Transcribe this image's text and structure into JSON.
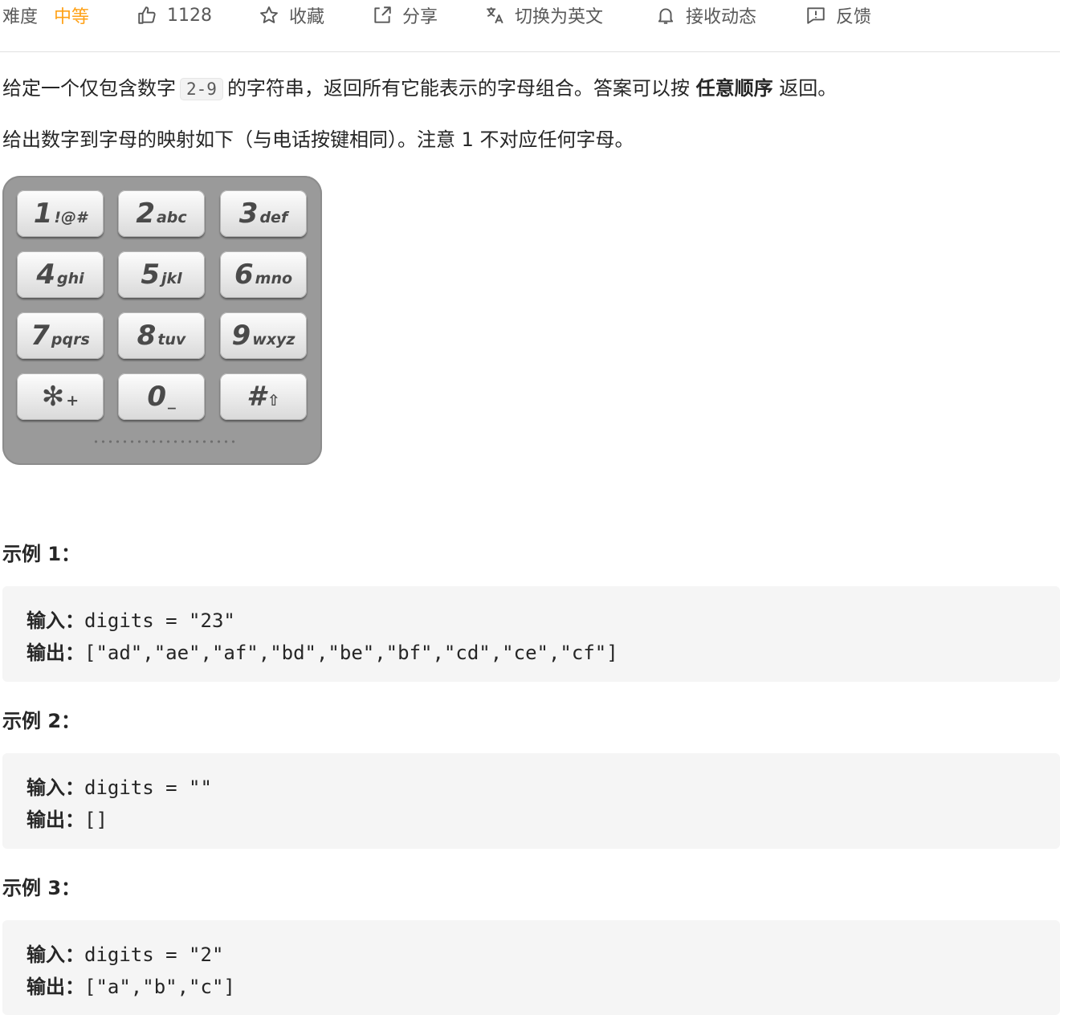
{
  "toolbar": {
    "difficulty_label": "难度",
    "difficulty_value": "中等",
    "difficulty_color": "#ffa116",
    "likes": "1128",
    "favorite": "收藏",
    "share": "分享",
    "translate": "切换为英文",
    "subscribe": "接收动态",
    "feedback": "反馈",
    "icons": [
      "thumbs-up-icon",
      "star-icon",
      "share-icon",
      "translate-icon",
      "bell-icon",
      "feedback-icon"
    ]
  },
  "description": {
    "p1_before": "给定一个仅包含数字",
    "p1_code": "2-9",
    "p1_middle": "的字符串，返回所有它能表示的字母组合。答案可以按",
    "p1_bold": "任意顺序",
    "p1_after": "返回。",
    "p2": "给出数字到字母的映射如下（与电话按键相同）。注意 1 不对应任何字母。"
  },
  "keypad": {
    "keys": [
      {
        "num": "1",
        "letters": "!@#"
      },
      {
        "num": "2",
        "letters": "abc"
      },
      {
        "num": "3",
        "letters": "def"
      },
      {
        "num": "4",
        "letters": "ghi"
      },
      {
        "num": "5",
        "letters": "jkl"
      },
      {
        "num": "6",
        "letters": "mno"
      },
      {
        "num": "7",
        "letters": "pqrs"
      },
      {
        "num": "8",
        "letters": "tuv"
      },
      {
        "num": "9",
        "letters": "wxyz"
      },
      {
        "num": "✻",
        "letters": "+"
      },
      {
        "num": "0",
        "letters": "_"
      },
      {
        "num": "#",
        "letters": "⇧"
      }
    ]
  },
  "examples": [
    {
      "title": "示例 1：",
      "input_label": "输入：",
      "input": "digits = \"23\"",
      "output_label": "输出：",
      "output": "[\"ad\",\"ae\",\"af\",\"bd\",\"be\",\"bf\",\"cd\",\"ce\",\"cf\"]"
    },
    {
      "title": "示例 2：",
      "input_label": "输入：",
      "input": "digits = \"\"",
      "output_label": "输出：",
      "output": "[]"
    },
    {
      "title": "示例 3：",
      "input_label": "输入：",
      "input": "digits = \"2\"",
      "output_label": "输出：",
      "output": "[\"a\",\"b\",\"c\"]"
    }
  ]
}
